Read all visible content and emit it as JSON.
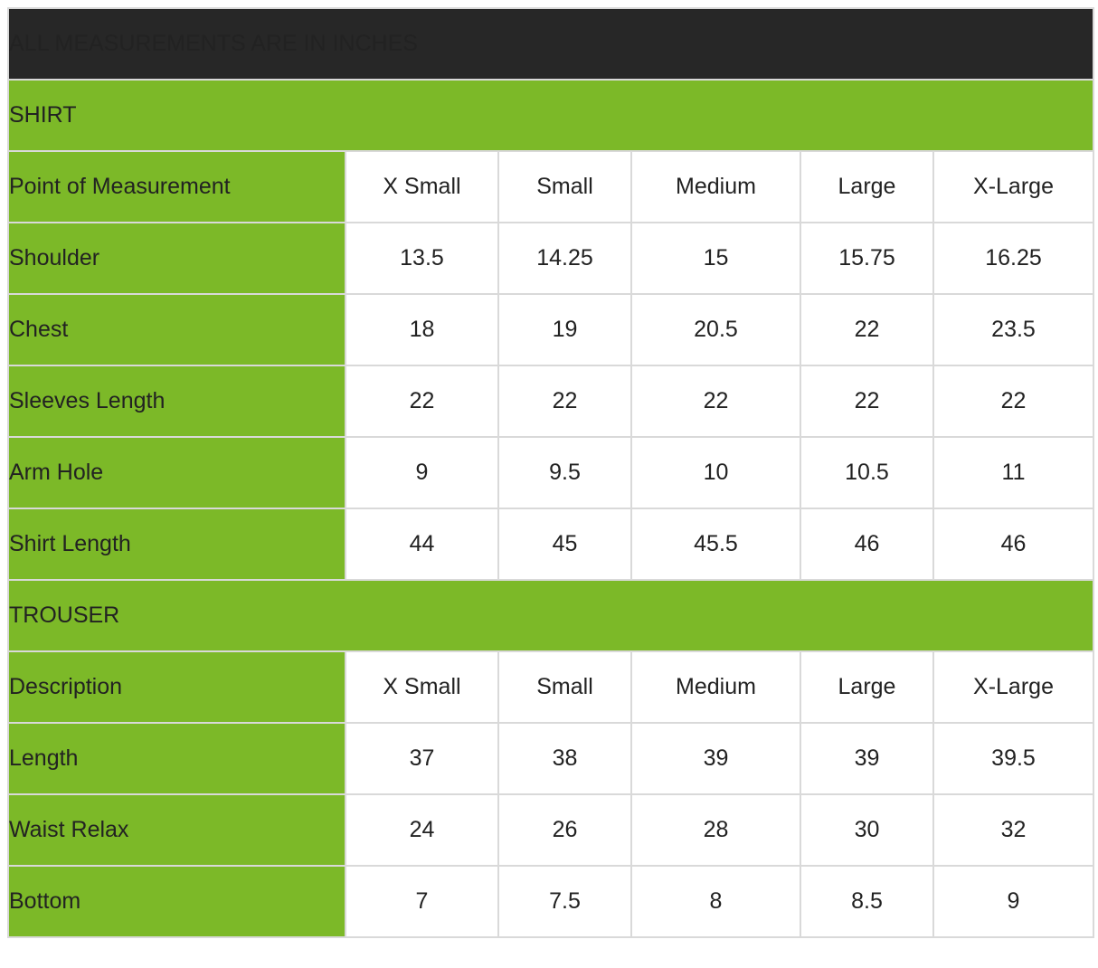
{
  "title": "ALL MEASUREMENTS ARE IN INCHES",
  "colors": {
    "header_bg": "#272727",
    "accent_green": "#7cb928",
    "border": "#d9d9d9"
  },
  "shirt": {
    "section_label": "SHIRT",
    "header": [
      "Point of Measurement",
      "X Small",
      "Small",
      "Medium",
      "Large",
      "X-Large"
    ],
    "rows": [
      [
        "Shoulder",
        "13.5",
        "14.25",
        "15",
        "15.75",
        "16.25"
      ],
      [
        "Chest",
        "18",
        "19",
        "20.5",
        "22",
        "23.5"
      ],
      [
        "Sleeves Length",
        "22",
        "22",
        "22",
        "22",
        "22"
      ],
      [
        "Arm Hole",
        "9",
        "9.5",
        "10",
        "10.5",
        "11"
      ],
      [
        "Shirt Length",
        "44",
        "45",
        "45.5",
        "46",
        "46"
      ]
    ]
  },
  "trouser": {
    "section_label": "TROUSER",
    "header": [
      "Description",
      "X Small",
      "Small",
      "Medium",
      "Large",
      "X-Large"
    ],
    "rows": [
      [
        "Length",
        "37",
        "38",
        "39",
        "39",
        "39.5"
      ],
      [
        "Waist Relax",
        "24",
        "26",
        "28",
        "30",
        "32"
      ],
      [
        "Bottom",
        "7",
        "7.5",
        "8",
        "8.5",
        "9"
      ]
    ]
  }
}
